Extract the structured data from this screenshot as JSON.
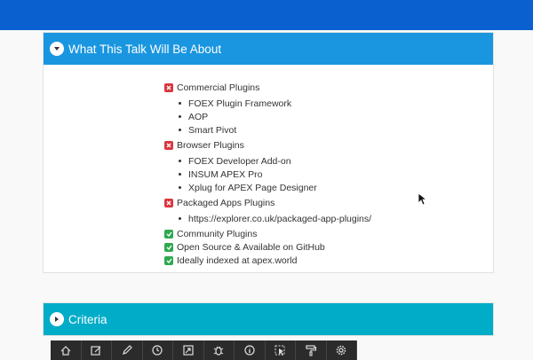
{
  "region1": {
    "title": "What This Talk Will Be About",
    "groups": [
      {
        "label": "Commercial Plugins",
        "status": "excluded",
        "items": [
          "FOEX Plugin Framework",
          "AOP",
          "Smart Pivot"
        ]
      },
      {
        "label": "Browser Plugins",
        "status": "excluded",
        "items": [
          "FOEX Developer Add-on",
          "INSUM APEX Pro",
          "Xplug for APEX Page Designer"
        ]
      },
      {
        "label": "Packaged Apps Plugins",
        "status": "excluded",
        "items": [
          "https://explorer.co.uk/packaged-app-plugins/"
        ]
      },
      {
        "label": "Community Plugins",
        "status": "included",
        "items": []
      },
      {
        "label": "Open Source & Available on GitHub",
        "status": "included",
        "items": []
      },
      {
        "label": "Ideally indexed at apex.world",
        "status": "included",
        "items": []
      }
    ]
  },
  "region2": {
    "title": "Criteria"
  },
  "toolbar": {
    "icons": [
      "home-icon",
      "edit-page-icon",
      "pencil-icon",
      "clock-icon",
      "share-icon",
      "debug-icon",
      "info-icon",
      "quick-edit-icon",
      "paint-roller-icon",
      "gear-icon"
    ]
  },
  "colors": {
    "topbar": "#0b60cf",
    "region1_header": "#1a96e0",
    "region2_header": "#00acc8",
    "excluded": "#d9363e",
    "included": "#2fa84f",
    "toolbar": "#2b2b2b"
  }
}
